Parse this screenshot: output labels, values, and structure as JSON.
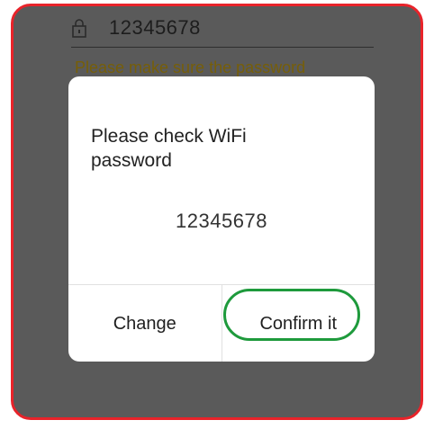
{
  "background": {
    "password_value": "12345678",
    "hint_text": "Please make sure the password"
  },
  "dialog": {
    "title": "Please check WiFi password",
    "password": "12345678",
    "buttons": {
      "change_label": "Change",
      "confirm_label": "Confirm it"
    }
  },
  "colors": {
    "frame_border": "#e8232a",
    "highlight_ring": "#1e9a3c",
    "overlay": "#5a5a5a"
  },
  "icons": {
    "password_field": "lock-icon"
  }
}
